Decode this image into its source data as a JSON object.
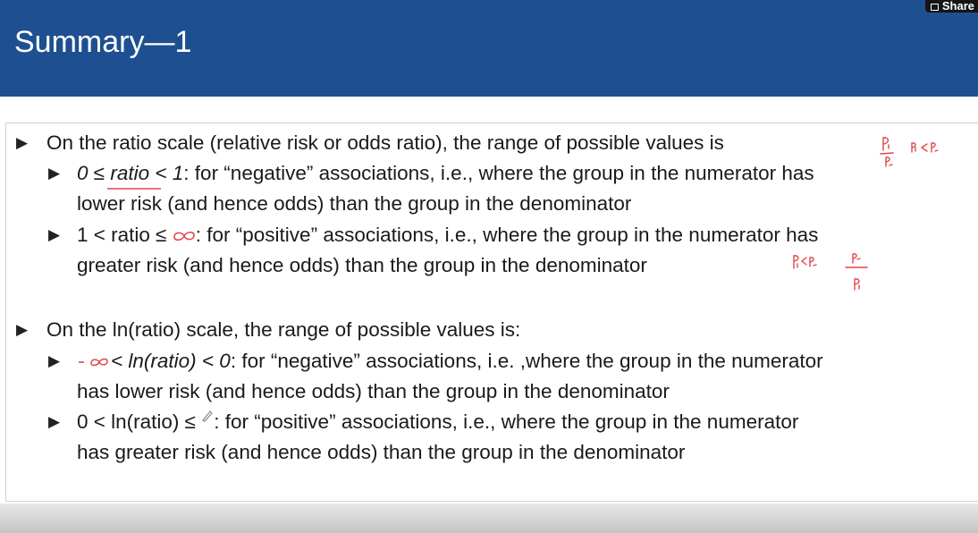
{
  "header": {
    "title": "Summary—1",
    "share_label": "Share",
    "bg_color": "#1e4f91"
  },
  "bullets": {
    "glyph": "▶",
    "icon": "triangle-bullet-icon"
  },
  "content": {
    "ratio": {
      "lead": "On the ratio scale (relative risk or odds ratio), the range of possible values is",
      "negative": {
        "condition": "0 ≤ ratio < 1",
        "line1": ": for “negative” associations, i.e., where the group in the numerator has",
        "line2": "lower risk (and hence odds) than the group in the denominator"
      },
      "positive": {
        "condition": "1 < ratio ≤ ",
        "line1": ": for “positive” associations, i.e., where the group in the numerator has",
        "line2": "greater risk (and hence odds) than the group in the denominator"
      }
    },
    "ln": {
      "lead": "On the ln(ratio) scale, the range of possible values is:",
      "negative": {
        "condition": "< ln(ratio) < 0",
        "line1": ": for “negative” associations, i.e. ,where the group in the numerator",
        "line2": "has lower risk (and hence odds) than the group in the denominator"
      },
      "positive": {
        "condition": "0 < ln(ratio) ≤ ",
        "line1": ": for “positive” associations, i.e., where the group in the numerator",
        "line2": "has greater risk (and hence odds) than the group in the denominator"
      }
    }
  },
  "ink_color": "#e0464b"
}
